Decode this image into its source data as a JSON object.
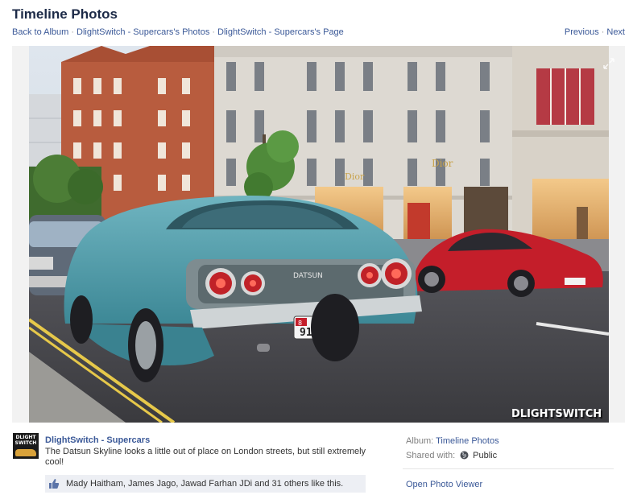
{
  "header": {
    "title": "Timeline Photos",
    "breadcrumbs": [
      "Back to Album",
      "DlightSwitch - Supercars's Photos",
      "DlightSwitch - Supercars's Page"
    ],
    "separator": "·",
    "previous": "Previous",
    "next": "Next"
  },
  "photo": {
    "icon": "expand-icon",
    "signage": [
      "Dior",
      "Dior"
    ],
    "plate_number": "91161",
    "plate_code": "8",
    "watermark": "DLIGHTSWITCH",
    "trunk_badge": "DATSUN",
    "colors": {
      "car_body": "#4f9aa8",
      "red_car": "#c41e2a",
      "road": "#4a4a4f",
      "sky": "#dfe6ee"
    }
  },
  "post": {
    "owner_name": "DlightSwitch - Supercars",
    "avatar_text": "DLIGHT SWITCH",
    "caption": "The Datsun Skyline looks a little out of place on London streets, but still extremely cool!",
    "likes_text": "Mady Haitham, James Jago, Jawad Farhan JDi and 31 others like this."
  },
  "sidebar": {
    "album_label": "Album:",
    "album_value": "Timeline Photos",
    "shared_label": "Shared with:",
    "shared_value": "Public",
    "open_viewer": "Open Photo Viewer"
  },
  "colors": {
    "link": "#3b5998",
    "title": "#1c2a47",
    "like_bar": "#edeff4"
  }
}
